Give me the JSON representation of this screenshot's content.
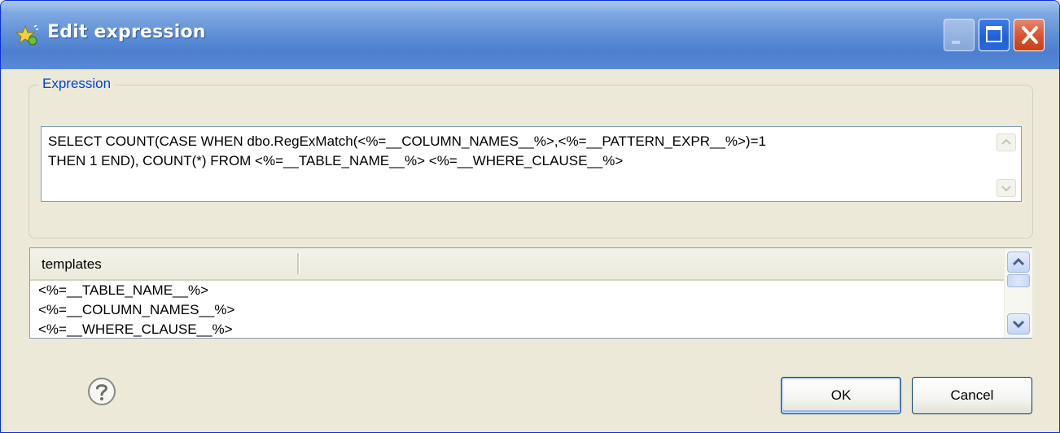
{
  "window": {
    "title": "Edit expression",
    "icon": "star-sparkle-icon"
  },
  "expression_group": {
    "label": "Expression",
    "text": "SELECT COUNT(CASE WHEN dbo.RegExMatch(<%=__COLUMN_NAMES__%>,<%=__PATTERN_EXPR__%>)=1\nTHEN 1 END), COUNT(*) FROM <%=__TABLE_NAME__%> <%=__WHERE_CLAUSE__%>"
  },
  "templates_table": {
    "column_header": "templates",
    "rows": [
      "<%=__TABLE_NAME__%>",
      "<%=__COLUMN_NAMES__%>",
      "<%=__WHERE_CLAUSE__%>"
    ]
  },
  "buttons": {
    "ok": "OK",
    "cancel": "Cancel"
  },
  "colors": {
    "title_bar": "#4c7fd0",
    "group_label": "#0046d5",
    "close_button": "#d9512d"
  }
}
